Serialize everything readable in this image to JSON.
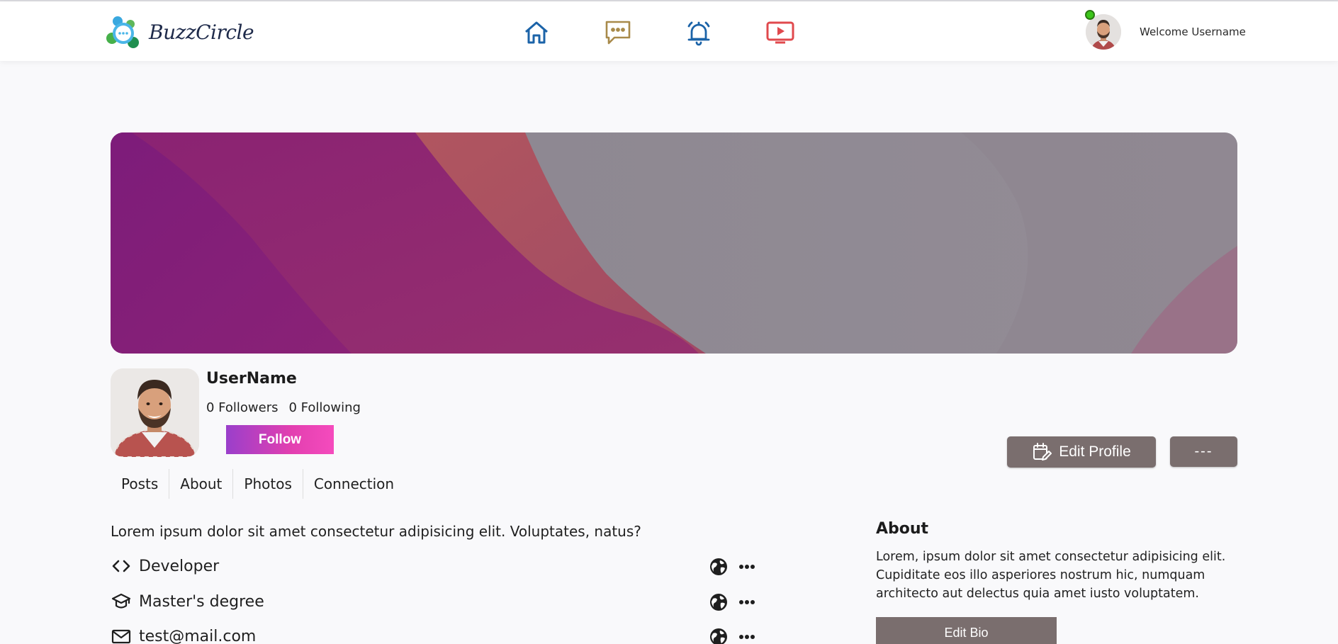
{
  "app": {
    "name": "BuzzCircle"
  },
  "header": {
    "nav": [
      {
        "name": "home",
        "icon": "home-icon",
        "color": "#1b63a8"
      },
      {
        "name": "messages",
        "icon": "chat-icon",
        "color": "#a88a4a"
      },
      {
        "name": "notifications",
        "icon": "bell-icon",
        "color": "#1b63a8"
      },
      {
        "name": "videos",
        "icon": "video-play-icon",
        "color": "#e0494d"
      }
    ],
    "welcome": "Welcome Username",
    "online_status_color": "#3cc61a"
  },
  "profile": {
    "username": "UserName",
    "followers": "0 Followers",
    "following": "0 Following",
    "follow_label": "Follow",
    "edit_profile_label": "Edit Profile",
    "more_label": "---"
  },
  "tabs": [
    {
      "label": "Posts"
    },
    {
      "label": "About"
    },
    {
      "label": "Photos"
    },
    {
      "label": "Connection"
    }
  ],
  "intro": "Lorem ipsum dolor sit amet consectetur adipisicing elit. Voluptates, natus?",
  "info": [
    {
      "icon": "code-icon",
      "text": "Developer"
    },
    {
      "icon": "graduation-cap-icon",
      "text": "Master's degree"
    },
    {
      "icon": "mail-icon",
      "text": "test@mail.com"
    }
  ],
  "about": {
    "title": "About",
    "text": "Lorem, ipsum dolor sit amet consectetur adipisicing elit. Cupiditate eos illo asperiores nostrum hic, numquam architecto aut delectus quia amet iusto voluptatem.",
    "edit_bio_label": "Edit Bio"
  },
  "colors": {
    "accent_gradient_start": "#9a3fcb",
    "accent_gradient_end": "#f54bbd",
    "button_gray": "#7a6e6e"
  }
}
